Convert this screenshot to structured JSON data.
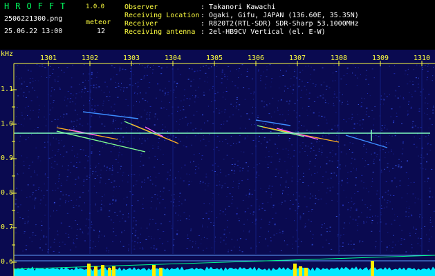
{
  "header": {
    "logo": "HROFFT",
    "version": "1.0.0",
    "filename": "2506221300.png",
    "datetime": "25.06.22 13:00",
    "meteor_label": "meteor",
    "meteor_count": "12",
    "fields": [
      {
        "label": "Observer",
        "value": ": Takanori Kawachi"
      },
      {
        "label": "Receiving Location",
        "value": ": Ogaki, Gifu, JAPAN (136.60E, 35.35N)"
      },
      {
        "label": "Receiver",
        "value": ": R820T2(RTL-SDR) SDR-Sharp 53.1000MHz"
      },
      {
        "label": "Receiving antenna",
        "value": ": 2el-HB9CV Vertical (el. E-W)"
      }
    ]
  },
  "plot": {
    "y_unit": "kHz",
    "y_ticks": [
      "1.1",
      "1.0",
      "0.9",
      "0.8",
      "0.7",
      "0.6"
    ],
    "x_ticks": [
      "1301",
      "1302",
      "1303",
      "1304",
      "1305",
      "1306",
      "1307",
      "1308",
      "1309",
      "1310"
    ],
    "colors": {
      "background": "#0a0a50",
      "axis_text": "#ffff40",
      "carrier": "#80ffc0",
      "level": "#00e8ff",
      "peaks": "#ffee00"
    }
  }
}
